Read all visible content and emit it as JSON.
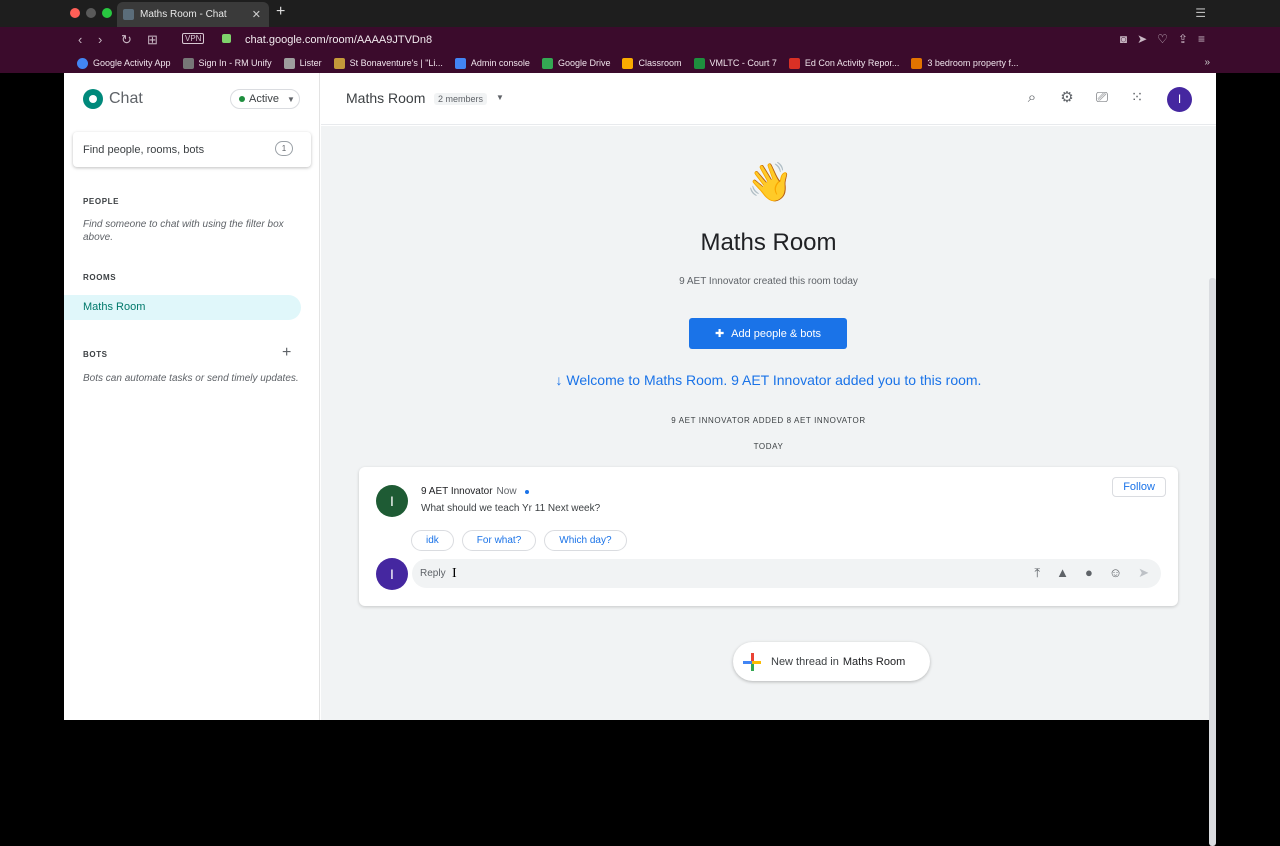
{
  "browser": {
    "tab_title": "Maths Room - Chat",
    "url": "chat.google.com/room/AAAA9JTVDn8",
    "vpn_label": "VPN",
    "bookmarks": [
      {
        "label": "Google Activity App",
        "color": "#4285f4"
      },
      {
        "label": "Sign In - RM Unify",
        "color": "#777777"
      },
      {
        "label": "Lister",
        "color": "#9e9e9e"
      },
      {
        "label": "St Bonaventure's | \"Li...",
        "color": "#c49a3a"
      },
      {
        "label": "Admin console",
        "color": "#4285f4"
      },
      {
        "label": "Google Drive",
        "color": "#34a853"
      },
      {
        "label": "Classroom",
        "color": "#f9ab00"
      },
      {
        "label": "VMLTC - Court 7",
        "color": "#1e8e3e"
      },
      {
        "label": "Ed Con Activity Repor...",
        "color": "#d93025"
      },
      {
        "label": "3 bedroom property f...",
        "color": "#e37400"
      }
    ]
  },
  "sidebar": {
    "app_name": "Chat",
    "status": "Active",
    "search_placeholder": "Find people, rooms, bots",
    "search_shortcut": "1",
    "people_title": "PEOPLE",
    "people_hint": "Find someone to chat with using the filter box above.",
    "rooms_title": "ROOMS",
    "rooms": [
      "Maths Room"
    ],
    "bots_title": "BOTS",
    "bots_hint": "Bots can automate tasks or send timely updates."
  },
  "header": {
    "room_name": "Maths Room",
    "members": "2 members",
    "avatar_initial": "I"
  },
  "main": {
    "title": "Maths Room",
    "created_text": "9 AET Innovator created this room today",
    "add_button": "Add people & bots",
    "welcome_text": "↓ Welcome to Maths Room. 9 AET Innovator added you to this room.",
    "system_line": "9 AET INNOVATOR ADDED 8 AET INNOVATOR",
    "date_divider": "TODAY",
    "thread": {
      "author": "9 AET Innovator",
      "author_initial": "I",
      "time": "Now",
      "message": "What should we teach Yr 11 Next week?",
      "follow_label": "Follow",
      "smart_replies": [
        "idk",
        "For what?",
        "Which day?"
      ],
      "reply_placeholder": "Reply",
      "reply_initial": "I"
    },
    "new_thread_label": "New thread in",
    "new_thread_room": "Maths Room"
  }
}
